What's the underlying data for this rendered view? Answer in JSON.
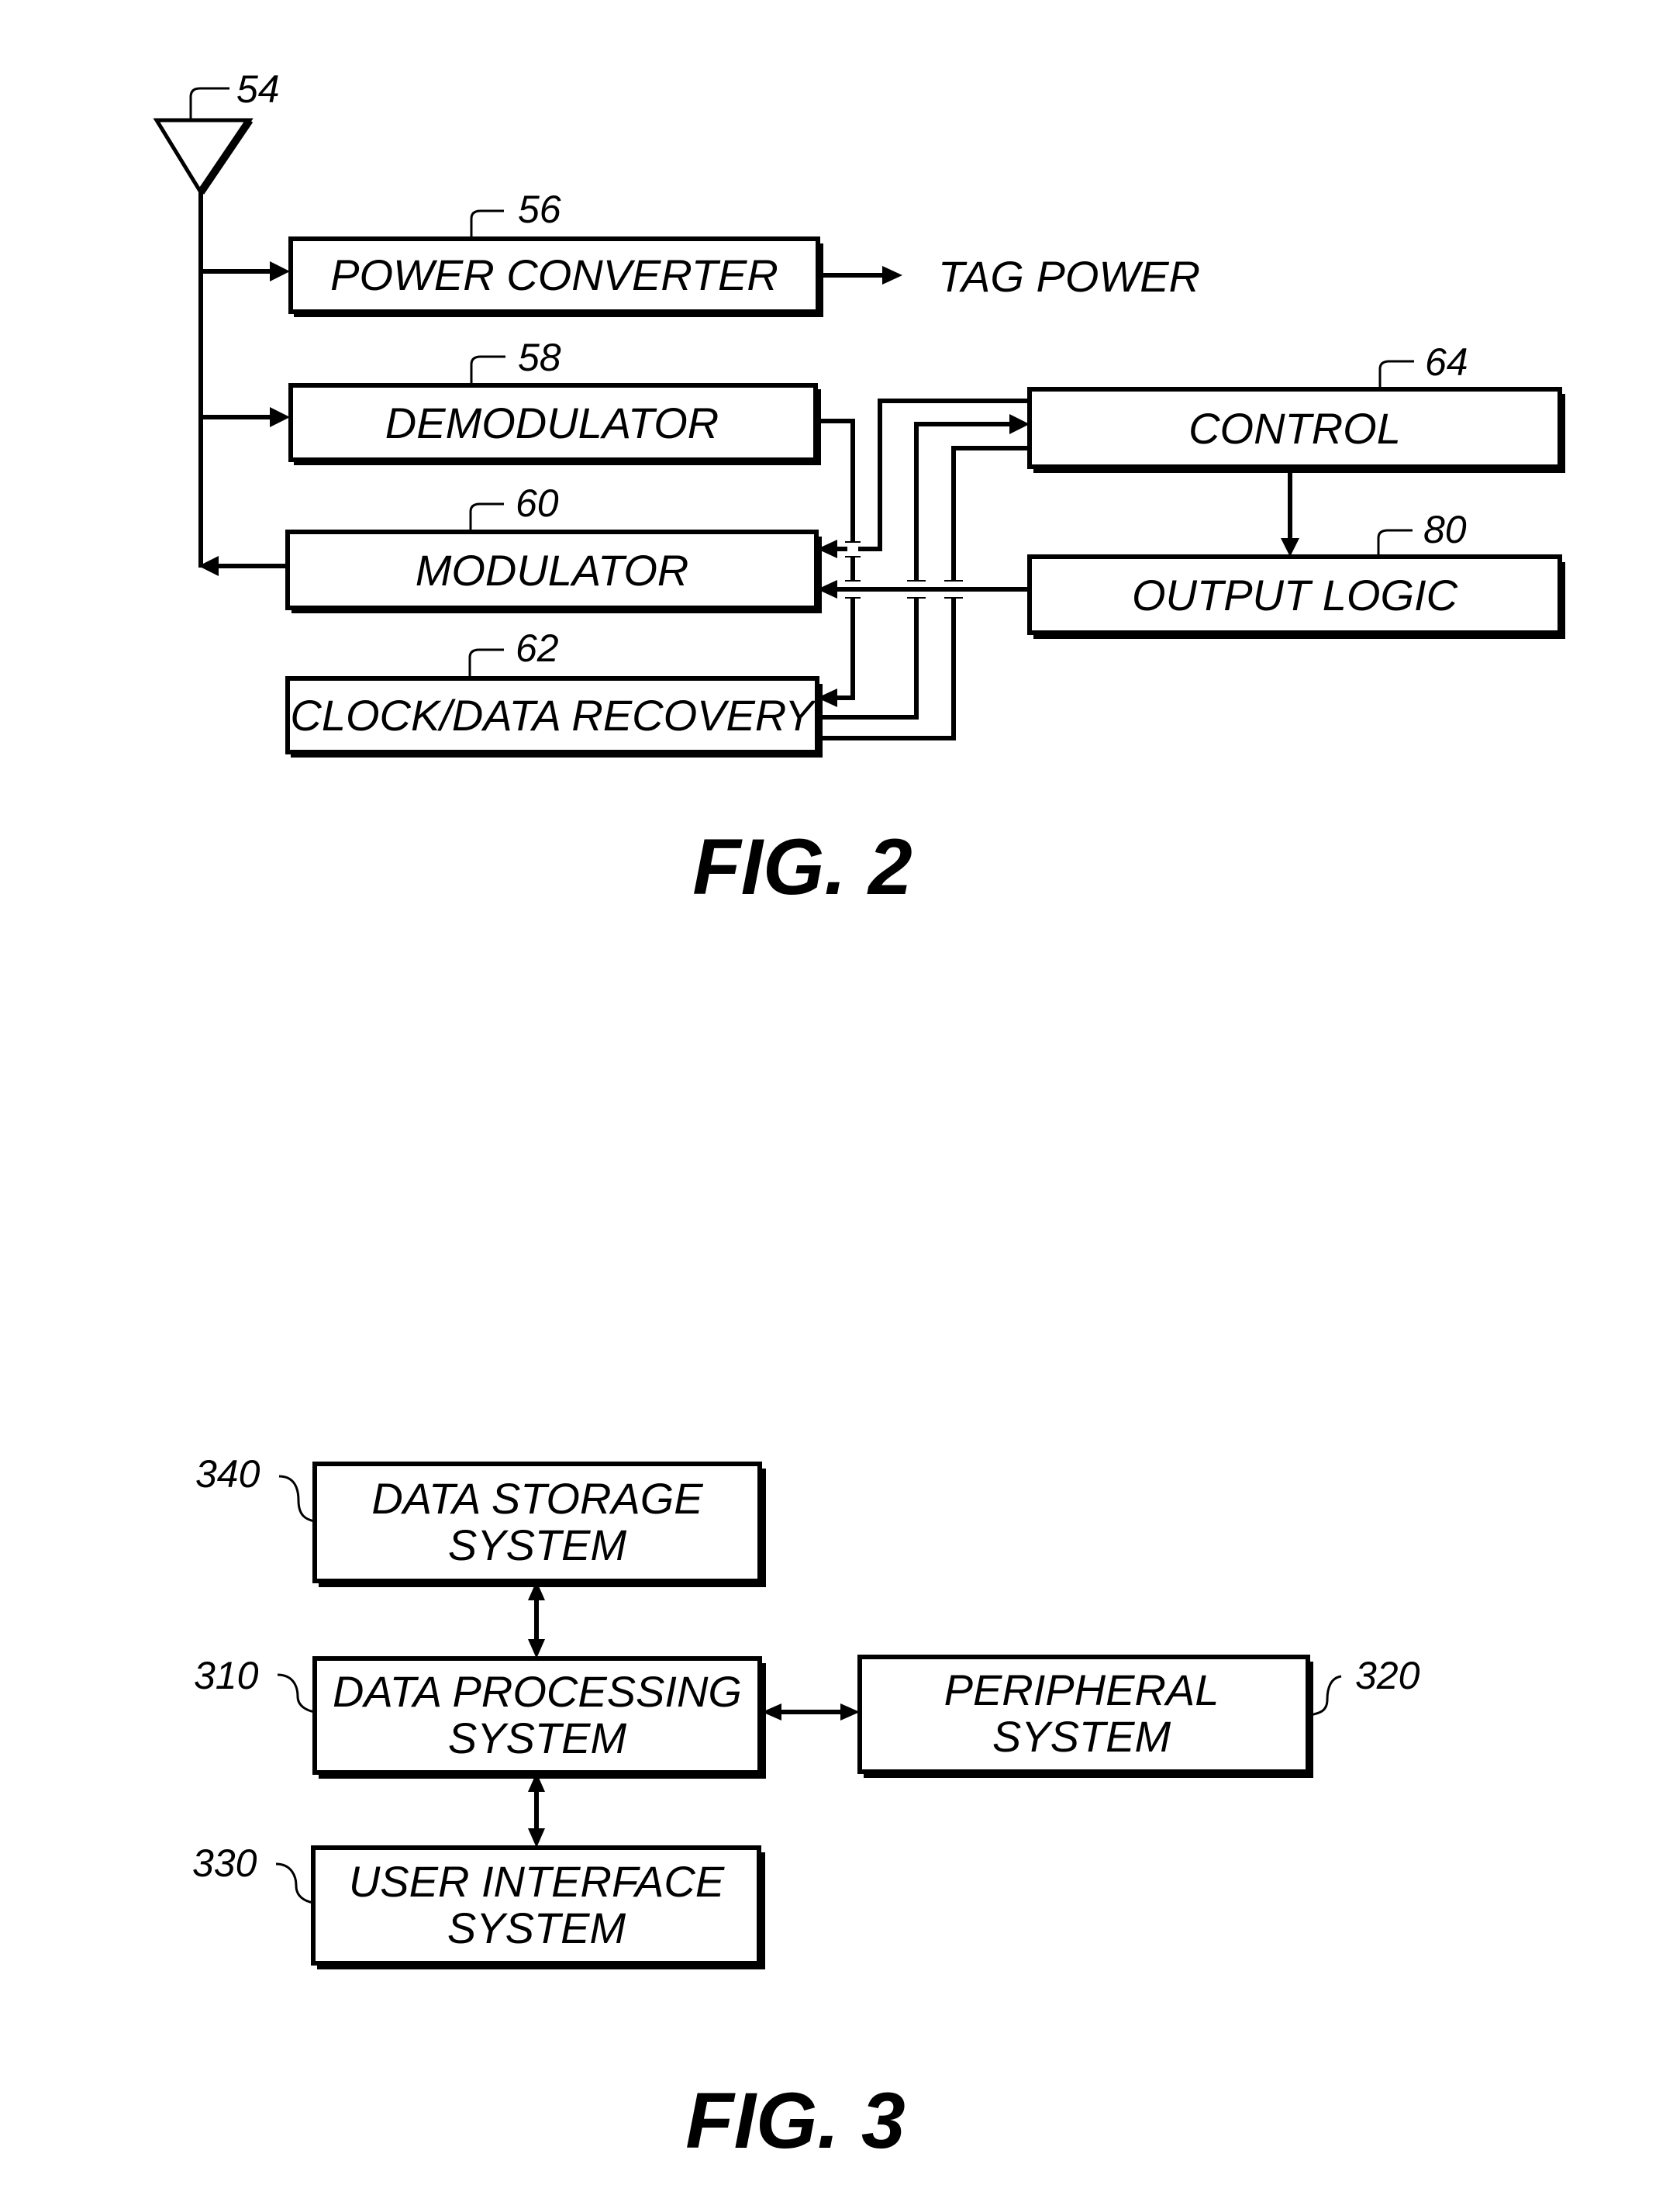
{
  "fig2": {
    "caption": "FIG. 2",
    "antenna": {
      "ref": "54"
    },
    "blocks": {
      "power_converter": {
        "label": "POWER CONVERTER",
        "ref": "56"
      },
      "demodulator": {
        "label": "DEMODULATOR",
        "ref": "58"
      },
      "modulator": {
        "label": "MODULATOR",
        "ref": "60"
      },
      "clock_data_recovery": {
        "label": "CLOCK/DATA RECOVERY",
        "ref": "62"
      },
      "control": {
        "label": "CONTROL",
        "ref": "64"
      },
      "output_logic": {
        "label": "OUTPUT LOGIC",
        "ref": "80"
      }
    },
    "tag_power_label": "TAG POWER",
    "connections": [
      {
        "from": "antenna",
        "to": "power_converter"
      },
      {
        "from": "antenna",
        "to": "demodulator"
      },
      {
        "from": "modulator",
        "to": "antenna"
      },
      {
        "from": "power_converter",
        "to": "tag_power"
      },
      {
        "from": "demodulator",
        "to": "clock_data_recovery"
      },
      {
        "from": "control",
        "to": "modulator"
      },
      {
        "from": "clock_data_recovery",
        "to": "control"
      },
      {
        "from": "clock_data_recovery",
        "to": "control"
      },
      {
        "from": "control",
        "to": "output_logic"
      },
      {
        "from": "output_logic",
        "to": "modulator"
      }
    ]
  },
  "fig3": {
    "caption": "FIG. 3",
    "blocks": {
      "data_storage": {
        "line1": "DATA STORAGE",
        "line2": "SYSTEM",
        "ref": "340"
      },
      "data_processing": {
        "line1": "DATA PROCESSING",
        "line2": "SYSTEM",
        "ref": "310"
      },
      "peripheral": {
        "line1": "PERIPHERAL",
        "line2": "SYSTEM",
        "ref": "320"
      },
      "user_interface": {
        "line1": "USER INTERFACE",
        "line2": "SYSTEM",
        "ref": "330"
      }
    },
    "connections": [
      {
        "from": "data_storage",
        "to": "data_processing",
        "bidirectional": true
      },
      {
        "from": "data_processing",
        "to": "peripheral",
        "bidirectional": true
      },
      {
        "from": "data_processing",
        "to": "user_interface",
        "bidirectional": true
      }
    ]
  }
}
